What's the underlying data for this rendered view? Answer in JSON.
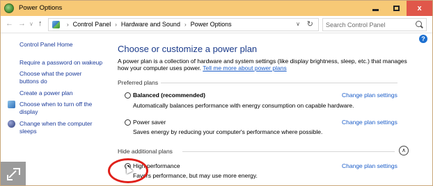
{
  "window": {
    "title": "Power Options",
    "close_glyph": "x"
  },
  "address_bar": {
    "crumbs": [
      "Control Panel",
      "Hardware and Sound",
      "Power Options"
    ],
    "search_placeholder": "Search Control Panel"
  },
  "sidebar": {
    "home": "Control Panel Home",
    "links": [
      "Require a password on wakeup",
      "Choose what the power buttons do",
      "Create a power plan",
      "Choose when to turn off the display",
      "Change when the computer sleeps"
    ]
  },
  "main": {
    "heading": "Choose or customize a power plan",
    "description": "A power plan is a collection of hardware and system settings (like display brightness, sleep, etc.) that manages how your computer uses power. ",
    "description_link": "Tell me more about power plans",
    "preferred_label": "Preferred plans",
    "hide_label": "Hide additional plans",
    "plans": [
      {
        "name": "Balanced (recommended)",
        "description": "Automatically balances performance with energy consumption on capable hardware.",
        "link": "Change plan settings",
        "selected": false
      },
      {
        "name": "Power saver",
        "description": "Saves energy by reducing your computer's performance where possible.",
        "link": "Change plan settings",
        "selected": false
      },
      {
        "name": "High performance",
        "description": "Favors performance, but may use more energy.",
        "link": "Change plan settings",
        "selected": true
      }
    ]
  },
  "colors": {
    "titlebar": "#f7c976",
    "close_button": "#e0574a",
    "link": "#1a5cc8",
    "heading": "#1a3a8a",
    "highlight_ring": "#e0201a"
  }
}
